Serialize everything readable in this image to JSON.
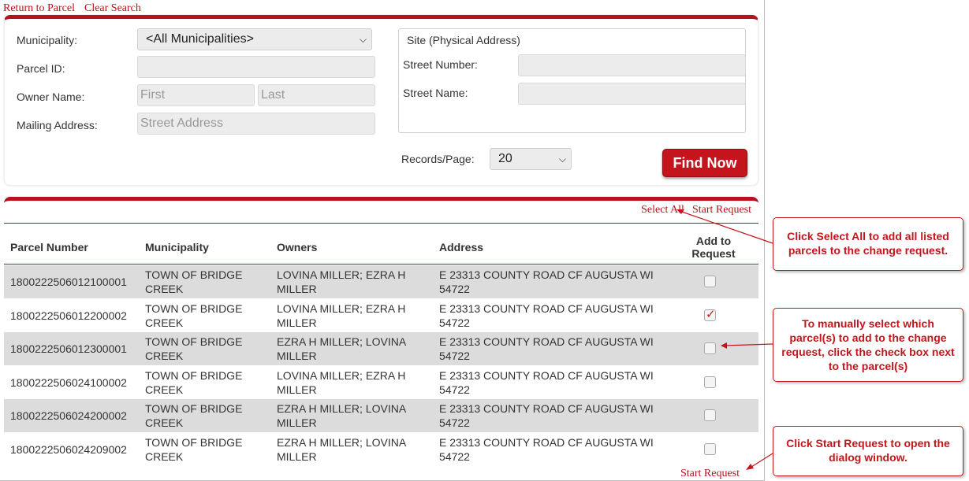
{
  "top_links": {
    "return": "Return to Parcel",
    "clear": "Clear Search"
  },
  "search": {
    "municipality_label": "Municipality:",
    "municipality_value": "<All Municipalities>",
    "parcel_label": "Parcel ID:",
    "owner_label": "Owner Name:",
    "owner_first_ph": "First",
    "owner_last_ph": "Last",
    "mailing_label": "Mailing Address:",
    "mailing_ph": "Street Address",
    "site_title": "Site (Physical Address)",
    "street_number_label": "Street Number:",
    "street_name_label": "Street Name:",
    "records_label": "Records/Page:",
    "records_value": "20",
    "find_label": "Find Now"
  },
  "results": {
    "select_all": "Select All",
    "start_request": "Start Request",
    "bottom_start_request": "Start Request",
    "columns": {
      "parcel": "Parcel Number",
      "municipality": "Municipality",
      "owners": "Owners",
      "address": "Address",
      "add": "Add to Request"
    },
    "rows": [
      {
        "parcel": "1800222506012100001",
        "municipality": "TOWN OF BRIDGE CREEK",
        "owners": "LOVINA MILLER; EZRA H MILLER",
        "address": "E 23313 COUNTY ROAD CF AUGUSTA WI 54722",
        "checked": false
      },
      {
        "parcel": "1800222506012200002",
        "municipality": "TOWN OF BRIDGE CREEK",
        "owners": "LOVINA MILLER; EZRA H MILLER",
        "address": "E 23313 COUNTY ROAD CF AUGUSTA WI 54722",
        "checked": true
      },
      {
        "parcel": "1800222506012300001",
        "municipality": "TOWN OF BRIDGE CREEK",
        "owners": "EZRA H MILLER; LOVINA MILLER",
        "address": "E 23313 COUNTY ROAD CF AUGUSTA WI 54722",
        "checked": false
      },
      {
        "parcel": "1800222506024100002",
        "municipality": "TOWN OF BRIDGE CREEK",
        "owners": "LOVINA MILLER; EZRA H MILLER",
        "address": "E 23313 COUNTY ROAD CF AUGUSTA WI 54722",
        "checked": false
      },
      {
        "parcel": "1800222506024200002",
        "municipality": "TOWN OF BRIDGE CREEK",
        "owners": "EZRA H MILLER; LOVINA MILLER",
        "address": "E 23313 COUNTY ROAD CF AUGUSTA WI 54722",
        "checked": false
      },
      {
        "parcel": "1800222506024209002",
        "municipality": "TOWN OF BRIDGE CREEK",
        "owners": "EZRA H MILLER; LOVINA MILLER",
        "address": "E 23313 COUNTY ROAD CF AUGUSTA WI 54722",
        "checked": false
      }
    ]
  },
  "callouts": {
    "select_all": "Click Select All to add all listed parcels to the change request.",
    "manual": "To manually select which parcel(s) to add to the change request, click the check box next to the parcel(s)",
    "start": "Click Start Request to open the dialog window."
  },
  "colors": {
    "accent": "#b5121b",
    "button": "#c4151c"
  }
}
